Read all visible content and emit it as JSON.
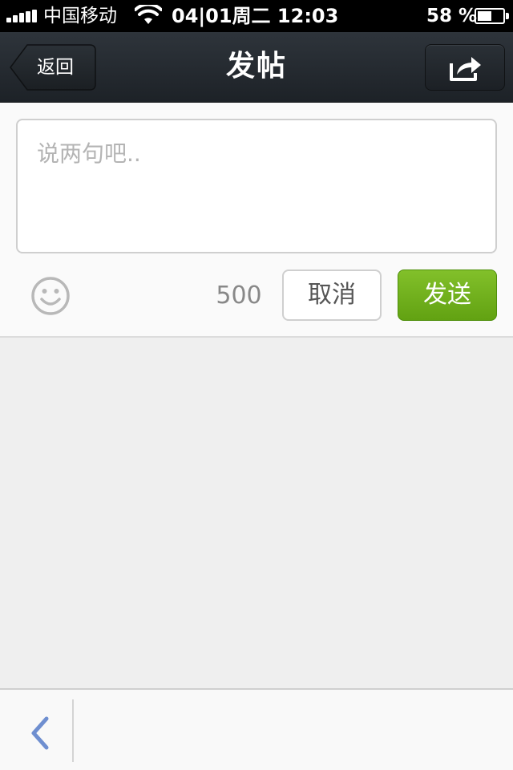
{
  "status_bar": {
    "carrier": "中国移动",
    "time": "04|01周二 12:03",
    "battery_percent": "58 %",
    "battery_level": 0.58
  },
  "nav": {
    "back_label": "返回",
    "title": "发帖",
    "share_icon": "share-icon"
  },
  "compose": {
    "placeholder": "说两句吧..",
    "value": "",
    "char_count": "500",
    "emoji_icon": "smiley-icon",
    "cancel_label": "取消",
    "send_label": "发送"
  },
  "toolbar": {
    "back_icon": "chevron-left-icon"
  },
  "colors": {
    "nav_bg": "#23282d",
    "send_green": "#6fb01e",
    "page_bg": "#efefef",
    "chevron_blue": "#6f8fd0"
  }
}
